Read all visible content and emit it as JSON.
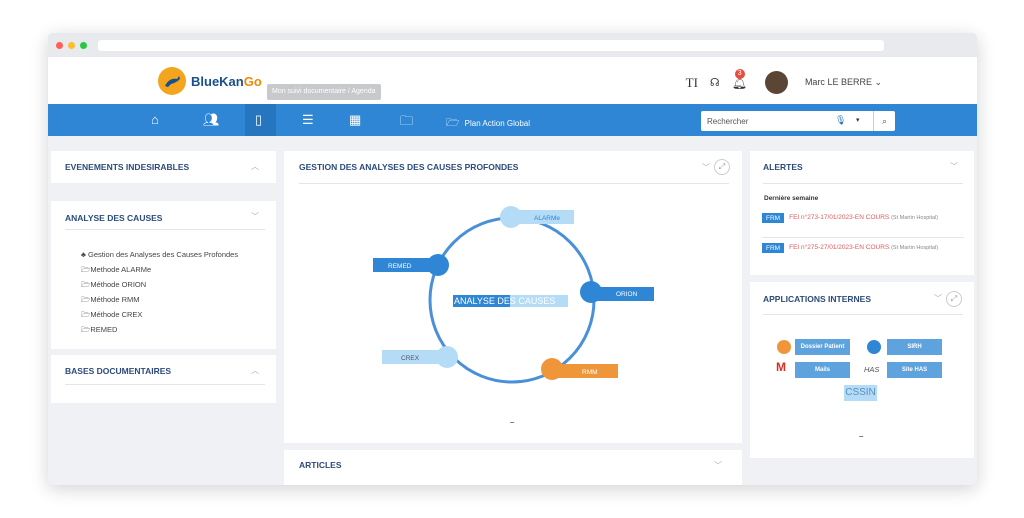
{
  "brand": {
    "name_part1": "BlueKan",
    "name_part2": "Go",
    "tooltip": "Mon suivi documentaire / Agenda"
  },
  "header": {
    "user_name": "Marc LE BERRE ⌄",
    "text_tool": "TI",
    "notif_count": "3"
  },
  "nav": {
    "plan_label": "Plan Action Global",
    "search_placeholder": "Rechercher"
  },
  "left": {
    "ei_title": "EVENEMENTS INDESIRABLES",
    "adc_title": "ANALYSE DES CAUSES",
    "adc_items": [
      "Gestion des Analyses des Causes Profondes",
      "Methode ALARMe",
      "Méthode ORION",
      "Méthode RMM",
      "Méthode CREX",
      "REMED"
    ],
    "bd_title": "BASES DOCUMENTAIRES"
  },
  "center": {
    "title": "GESTION DES ANALYSES DES CAUSES PROFONDES",
    "center_label": "ANALYSE DES CAUSES",
    "nodes": [
      "ALARMe",
      "ORION",
      "RMM",
      "CREX",
      "REMED"
    ],
    "minus": "–",
    "articles_title": "ARTICLES"
  },
  "right": {
    "alerts_title": "ALERTES",
    "week_label": "Dernière semaine",
    "alerts": [
      {
        "tag": "FRM",
        "text": "FEI n°273-17/01/2023-EN COURS",
        "site": "(St Martin Hospital)"
      },
      {
        "tag": "FRM",
        "text": "FEI n°275-27/01/2023-EN COURS",
        "site": "(St Martin Hospital)"
      }
    ],
    "apps_title": "APPLICATIONS INTERNES",
    "apps": [
      "Dossier Patient",
      "SIRH",
      "Mails",
      "Site HAS",
      "CSSIN"
    ],
    "has_logo": "HAS",
    "minus": "–"
  },
  "colors": {
    "nav": "#2e86d5",
    "accent_orange": "#f0963a",
    "ring": "#4a90d9",
    "light_blue": "#b4dcf7"
  }
}
